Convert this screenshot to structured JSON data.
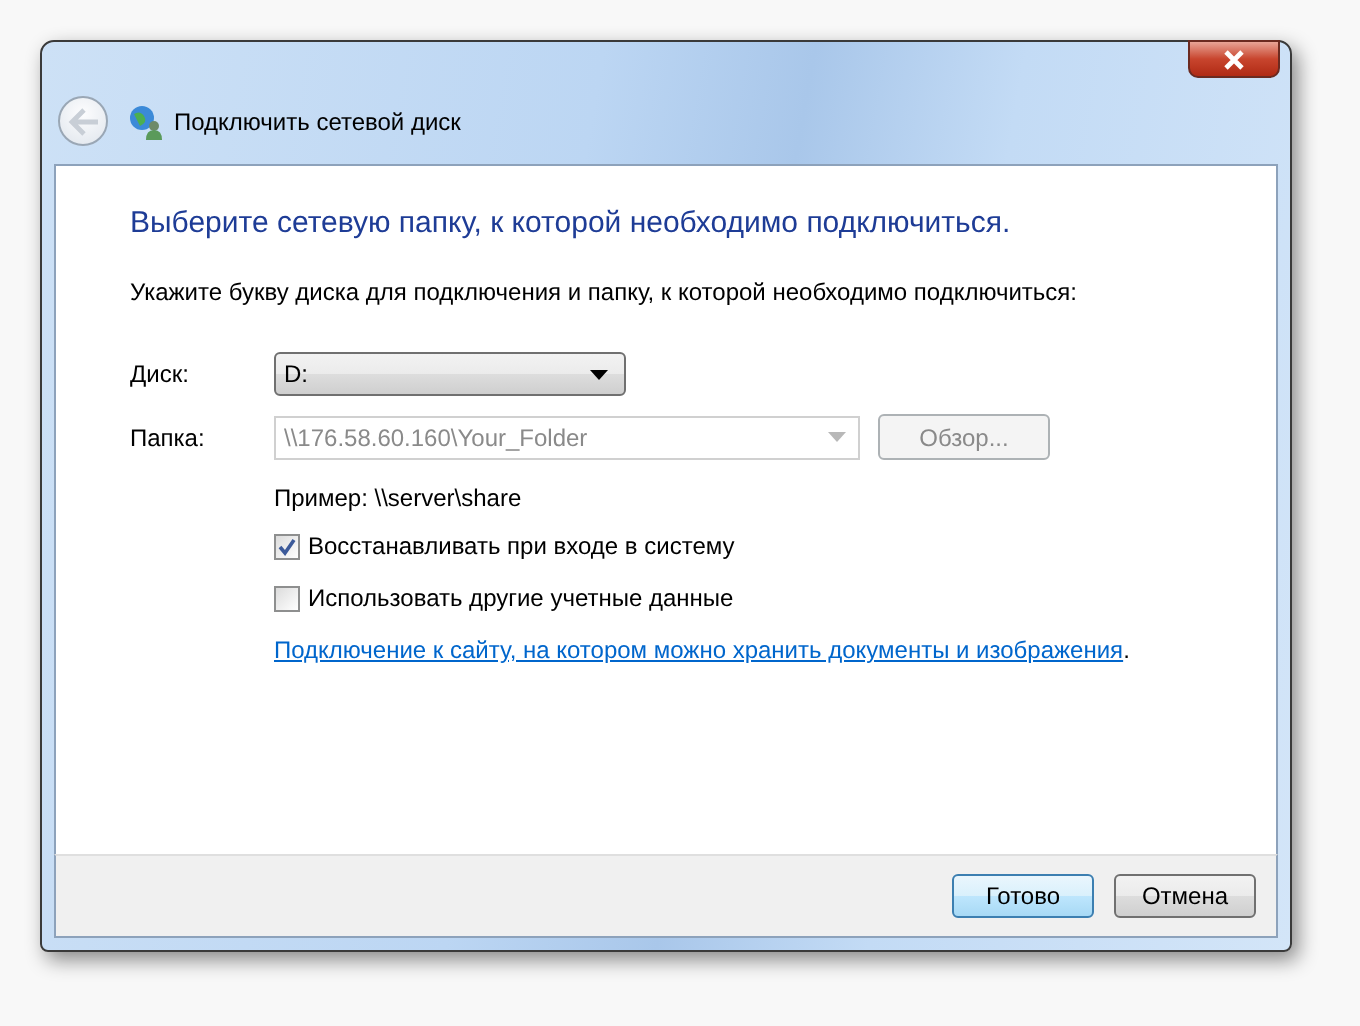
{
  "window": {
    "title": "Подключить сетевой диск"
  },
  "heading": "Выберите сетевую папку, к которой необходимо подключиться.",
  "instruction": "Укажите букву диска для подключения и папку, к которой необходимо подключиться:",
  "drive": {
    "label": "Диск:",
    "value": "D:"
  },
  "folder": {
    "label": "Папка:",
    "value": "\\\\176.58.60.160\\Your_Folder",
    "disabled": true
  },
  "browse_button": {
    "label": "Обзор...",
    "disabled": true
  },
  "example": "Пример: \\\\server\\share",
  "checkboxes": [
    {
      "label": "Восстанавливать при входе в систему",
      "checked": true
    },
    {
      "label": "Использовать другие учетные данные",
      "checked": false
    }
  ],
  "link": {
    "text": "Подключение к сайту, на котором можно хранить документы и изображения",
    "suffix": "."
  },
  "buttons": [
    {
      "label": "Готово",
      "default": true
    },
    {
      "label": "Отмена",
      "default": false
    }
  ]
}
